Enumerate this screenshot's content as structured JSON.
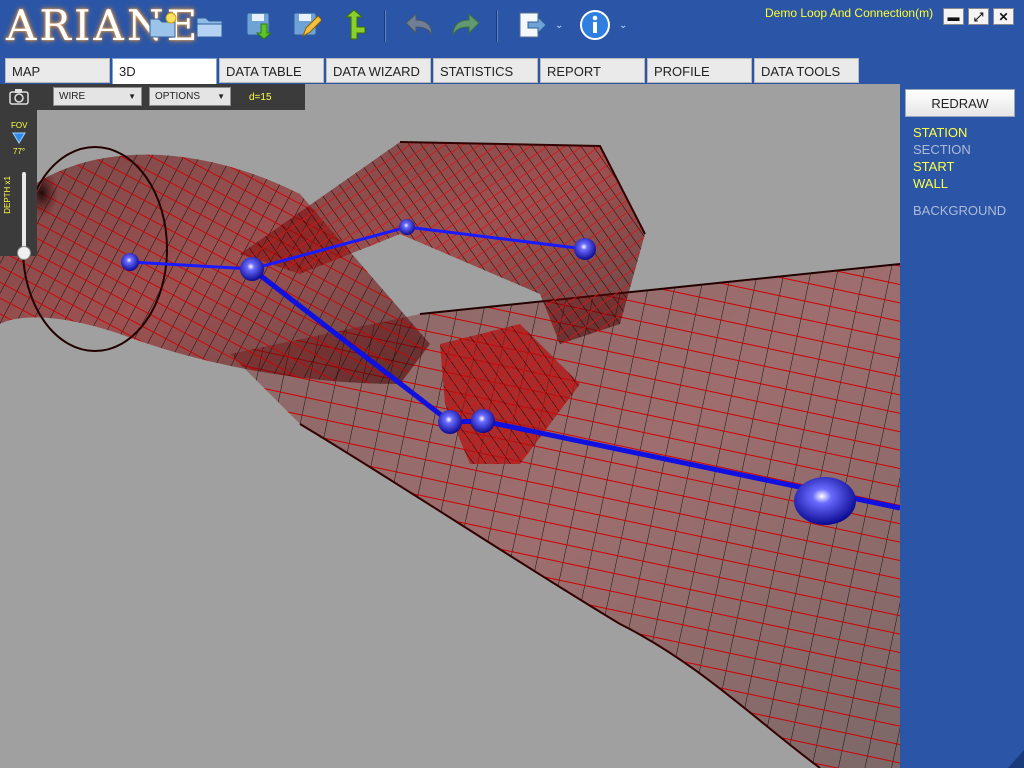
{
  "app": {
    "logo": "ARIANE",
    "window_title": "Demo Loop And Connection(m)",
    "window_controls": {
      "minimize": "▬",
      "maximize": "⤢",
      "close": "✕"
    }
  },
  "toolbar": {
    "icons": [
      "new-folder-icon",
      "open-folder-icon",
      "save-download-icon",
      "save-edit-icon",
      "branch-arrow-icon",
      "undo-icon",
      "redo-icon",
      "export-icon",
      "info-icon"
    ]
  },
  "tabs": [
    {
      "label": "MAP",
      "active": false
    },
    {
      "label": "3D",
      "active": true
    },
    {
      "label": "DATA TABLE",
      "active": false
    },
    {
      "label": "DATA WIZARD",
      "active": false
    },
    {
      "label": "STATISTICS",
      "active": false
    },
    {
      "label": "REPORT",
      "active": false
    },
    {
      "label": "PROFILE",
      "active": false
    },
    {
      "label": "DATA TOOLS",
      "active": false
    }
  ],
  "viewport": {
    "render_mode": "WIRE",
    "options_label": "OPTIONS",
    "depth_readout": "d=15",
    "fov_label": "FOV",
    "fov_value": "77°",
    "depth_scale_label": "DEPTH x1"
  },
  "right_panel": {
    "redraw_label": "REDRAW",
    "layers": [
      {
        "label": "STATION",
        "enabled": true
      },
      {
        "label": "SECTION",
        "enabled": false
      },
      {
        "label": "START",
        "enabled": true
      },
      {
        "label": "WALL",
        "enabled": true
      },
      {
        "label": "BACKGROUND",
        "enabled": false
      }
    ]
  },
  "colors": {
    "toolbar_bg": "#2b55a6",
    "viewport_bg": "#a0a0a0",
    "wall_wire": "#c00000",
    "survey_line": "#1010e0",
    "layer_on": "#ffff44",
    "layer_off": "#aebbd8"
  }
}
